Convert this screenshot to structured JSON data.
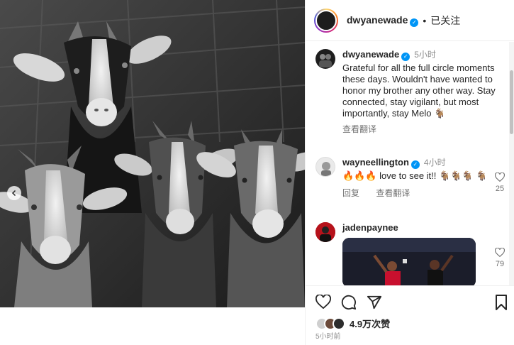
{
  "post": {
    "author": "dwyanewade",
    "follow_status": "已关注",
    "separator": "•",
    "time_ago": "5小时前",
    "likes": "4.9万次赞"
  },
  "caption": {
    "username": "dwyanewade",
    "time": "5小时",
    "text": "Grateful for all the full circle moments these days. Wouldn't have wanted to honor my brother any other way. Stay connected, stay vigilant, but most importantly, stay Melo 🐐",
    "translate": "查看翻译"
  },
  "comments": [
    {
      "username": "wayneellington",
      "time": "4小时",
      "text": "🔥🔥🔥 love to see it!! 🐐🐐🐐 🐐",
      "reply": "回复",
      "translate": "查看翻译",
      "likes": "25"
    },
    {
      "username": "jadenpaynee",
      "likes": "79"
    }
  ],
  "icons": {
    "heart": "heart-icon",
    "comment": "comment-icon",
    "share": "share-icon",
    "bookmark": "bookmark-icon",
    "verified": "verified-badge-icon",
    "carousel_prev": "chevron-left-icon"
  },
  "colors": {
    "verified_blue": "#0095f6",
    "muted_text": "#8e8e8e"
  }
}
